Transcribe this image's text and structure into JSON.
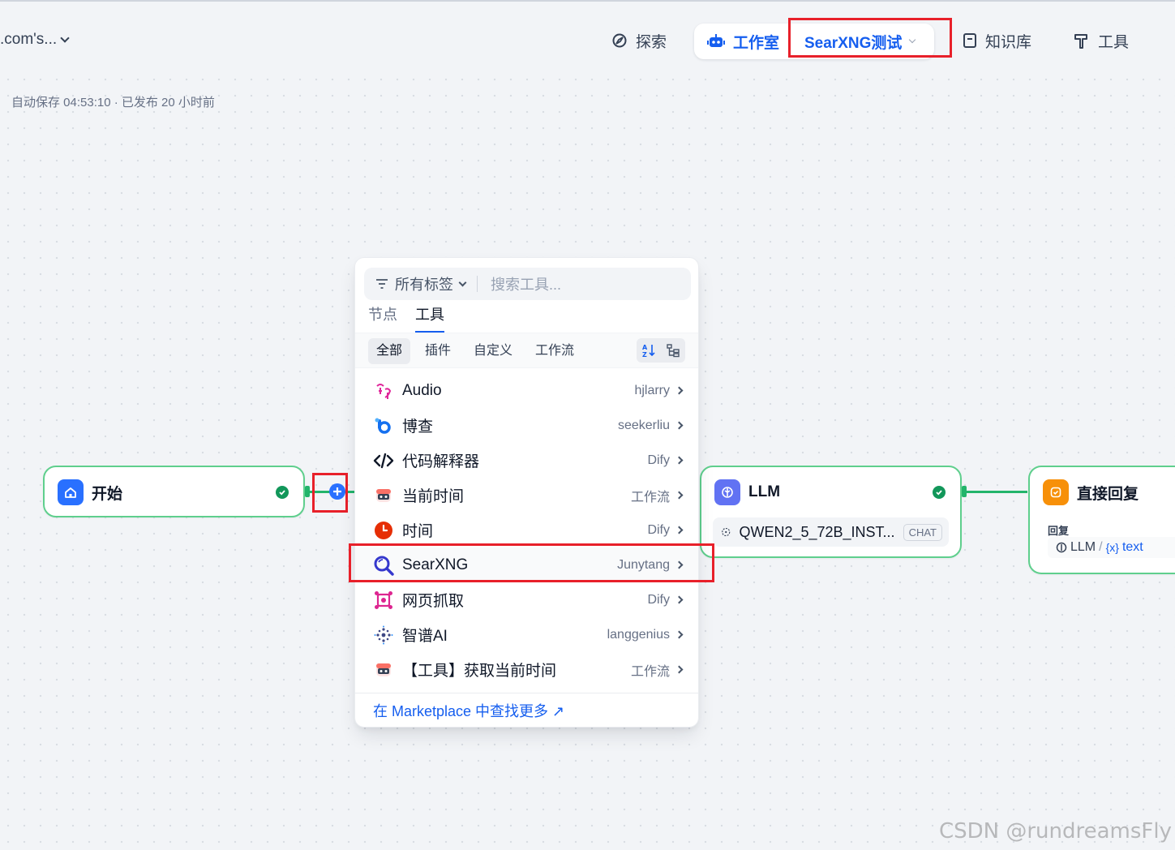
{
  "header": {
    "workspace": ".com's...",
    "nav": {
      "explore": "探索",
      "studio": "工作室",
      "app_name": "SearXNG测试",
      "knowledge": "知识库",
      "tools": "工具"
    }
  },
  "status": {
    "autosave": "自动保存 04:53:10 · 已发布 20 小时前"
  },
  "nodes": {
    "start": {
      "title": "开始"
    },
    "llm": {
      "title": "LLM",
      "model": "QWEN2_5_72B_INST...",
      "mode_badge": "CHAT"
    },
    "answer": {
      "title": "直接回复",
      "field_label": "回复",
      "source_node": "LLM",
      "var_prefix": "{x}",
      "var_name": "text"
    }
  },
  "tool_picker": {
    "tag_filter": "所有标签",
    "search_placeholder": "搜索工具...",
    "tabs": [
      "节点",
      "工具"
    ],
    "filters": [
      "全部",
      "插件",
      "自定义",
      "工作流"
    ],
    "tools": [
      {
        "name": "Audio",
        "author": "hjlarry",
        "icon": "audio-icon"
      },
      {
        "name": "博查",
        "author": "seekerliu",
        "icon": "bocha-icon"
      },
      {
        "name": "代码解释器",
        "author": "Dify",
        "icon": "code-icon"
      },
      {
        "name": "当前时间",
        "author": "工作流",
        "icon": "robot-icon"
      },
      {
        "name": "时间",
        "author": "Dify",
        "icon": "clock-icon"
      },
      {
        "name": "SearXNG",
        "author": "Junytang",
        "icon": "search-icon"
      },
      {
        "name": "网页抓取",
        "author": "Dify",
        "icon": "webscraper-icon"
      },
      {
        "name": "智谱AI",
        "author": "langgenius",
        "icon": "zhipu-icon"
      },
      {
        "name": "【工具】获取当前时间",
        "author": "工作流",
        "icon": "robot-icon"
      }
    ],
    "marketplace_link": "在 Marketplace 中查找更多 ↗"
  },
  "watermark": "CSDN @rundreamsFly",
  "colors": {
    "accent": "#155eef",
    "success": "#12975a",
    "edge": "#23b46b",
    "highlight": "#e8202a"
  }
}
